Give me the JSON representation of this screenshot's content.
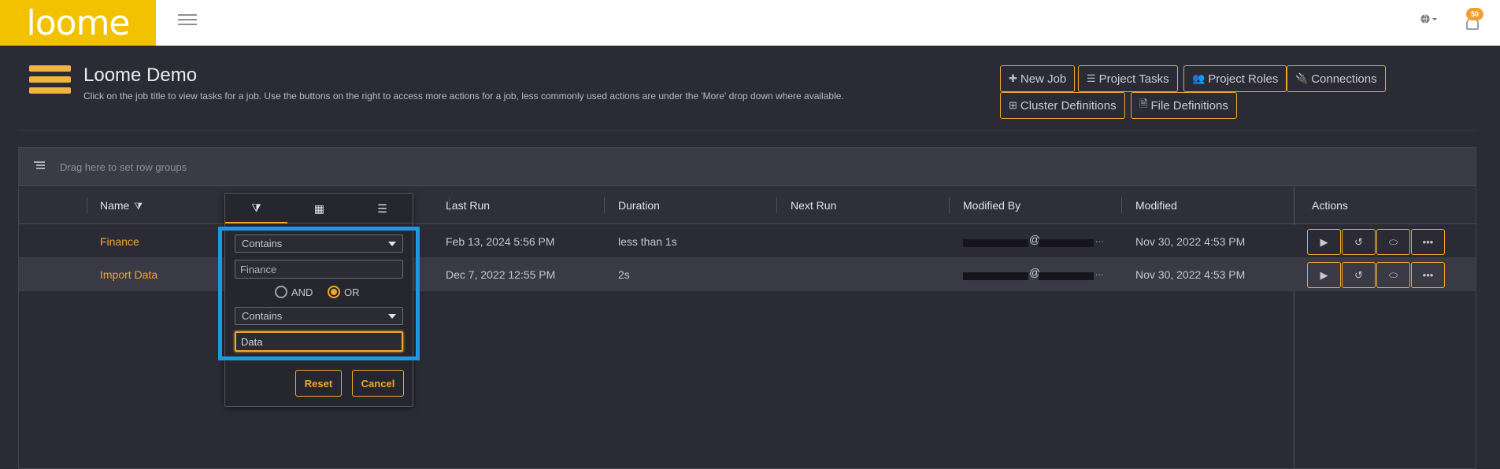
{
  "brand": {
    "logo_text": "loome",
    "logo_color": "#f2c200"
  },
  "topbar": {
    "notification_count": "50"
  },
  "header": {
    "title": "Loome Demo",
    "subtitle": "Click on the job title to view tasks for a job. Use the buttons on the right to access more actions for a job, less commonly used actions are under the 'More' drop down where available.",
    "buttons": [
      {
        "label": "New Job",
        "icon": "plus-icon"
      },
      {
        "label": "Project Tasks",
        "icon": "tasks-icon"
      },
      {
        "label": "Project Roles",
        "icon": "users-icon"
      },
      {
        "label": "Connections",
        "icon": "plug-icon"
      },
      {
        "label": "Cluster Definitions",
        "icon": "cluster-icon"
      },
      {
        "label": "File Definitions",
        "icon": "file-icon"
      }
    ]
  },
  "grid": {
    "group_hint": "Drag here to set row groups",
    "columns": [
      "Name",
      "Last Run",
      "Duration",
      "Next Run",
      "Modified By",
      "Modified",
      "Actions"
    ],
    "rows": [
      {
        "name": "Finance",
        "last_run": "Feb 13, 2024 5:56 PM",
        "duration": "less than 1s",
        "next_run": "",
        "modified_by_at": "@",
        "modified_by_ellipsis": "...",
        "modified": "Nov 30, 2022 4:53 PM"
      },
      {
        "name": "Import Data",
        "last_run": "Dec 7, 2022 12:55 PM",
        "duration": "2s",
        "next_run": "",
        "modified_by_at": "@",
        "modified_by_ellipsis": "...",
        "modified": "Nov 30, 2022 4:53 PM"
      }
    ],
    "row_action_icons": [
      "play-icon",
      "history-icon",
      "toggle-icon",
      "more-icon"
    ]
  },
  "filter_popup": {
    "condition1": {
      "operator": "Contains",
      "value": "Finance"
    },
    "join": {
      "and_label": "AND",
      "or_label": "OR",
      "selected": "OR"
    },
    "condition2": {
      "operator": "Contains",
      "value": "Data"
    },
    "reset_label": "Reset",
    "cancel_label": "Cancel",
    "highlight_color": "#1b9ae0"
  },
  "colors": {
    "accent": "#f0a82a",
    "background": "#2b2b36"
  }
}
